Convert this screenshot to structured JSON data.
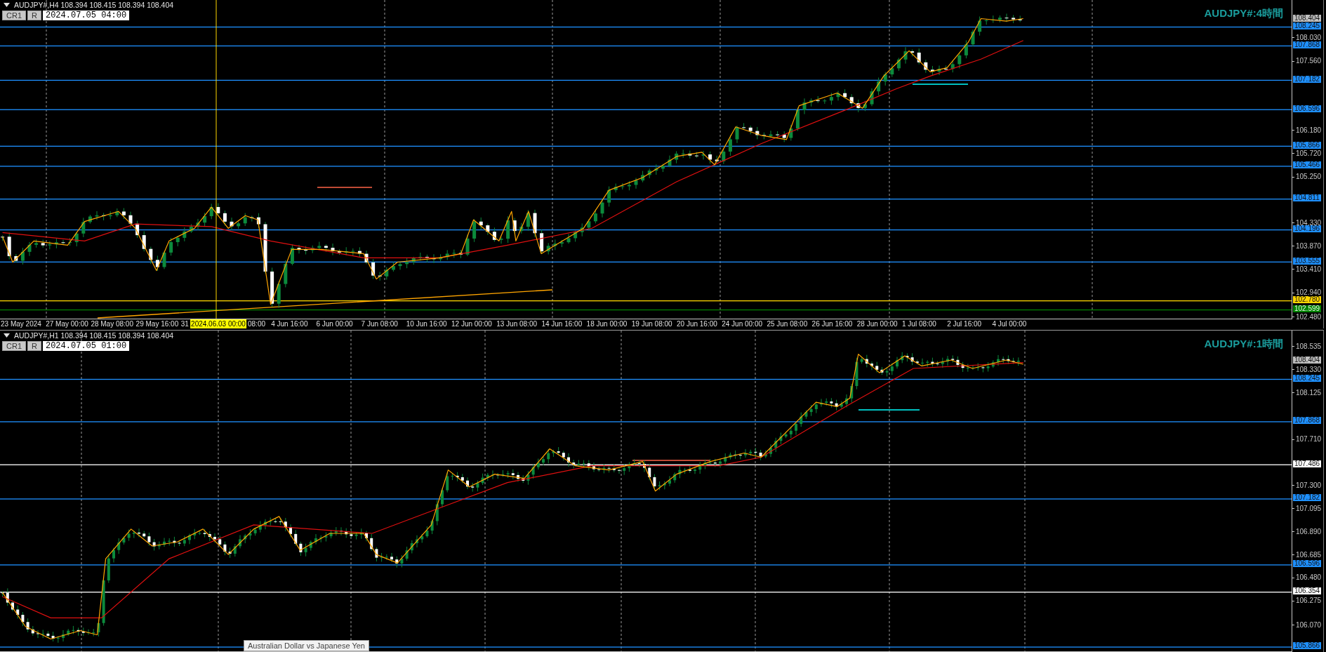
{
  "panes": [
    {
      "header": {
        "symbol_line": "AUDJPY#,H4  108.394 108.415 108.394 108.404",
        "buttons": [
          "CR1",
          "R"
        ],
        "date_field": "2024.07.05 04:00"
      },
      "title": "AUDJPY#:4時間",
      "price_ticks": [
        "108.030",
        "107.560",
        "106.180",
        "105.720",
        "105.250",
        "104.330",
        "103.870",
        "103.410",
        "102.940",
        "102.480"
      ],
      "levels": [
        {
          "label": "108.404",
          "kind": "bid",
          "color": "#c0c0c0"
        },
        {
          "label": "108.245",
          "kind": "line",
          "color": "#1e90ff"
        },
        {
          "label": "107.868",
          "kind": "line",
          "color": "#1e90ff"
        },
        {
          "label": "107.182",
          "kind": "line",
          "color": "#1e90ff"
        },
        {
          "label": "106.596",
          "kind": "line",
          "color": "#1e90ff"
        },
        {
          "label": "105.866",
          "kind": "line",
          "color": "#1e90ff"
        },
        {
          "label": "105.466",
          "kind": "line",
          "color": "#1e90ff"
        },
        {
          "label": "104.811",
          "kind": "line",
          "color": "#1e90ff"
        },
        {
          "label": "104.196",
          "kind": "line",
          "color": "#1e90ff"
        },
        {
          "label": "103.555",
          "kind": "line",
          "color": "#1e90ff"
        },
        {
          "label": "102.780",
          "kind": "line",
          "color": "#ffd700"
        },
        {
          "label": "102.599",
          "kind": "line",
          "color": "#008000"
        }
      ],
      "time_axis": [
        {
          "text": "23 May 2024",
          "kind": "date"
        },
        {
          "text": "27 May 00:00",
          "kind": "date"
        },
        {
          "text": "28 May 08:00",
          "kind": "date"
        },
        {
          "text": "29 May 16:00",
          "kind": "date"
        },
        {
          "text": "31",
          "kind": "date"
        },
        {
          "text": "2024.06.03 00:00",
          "kind": "cursor"
        },
        {
          "text": "08:00",
          "kind": "tail"
        },
        {
          "text": "4 Jun 16:00",
          "kind": "date"
        },
        {
          "text": "6 Jun 00:00",
          "kind": "date"
        },
        {
          "text": "7 Jun 08:00",
          "kind": "date"
        },
        {
          "text": "10 Jun 16:00",
          "kind": "date"
        },
        {
          "text": "12 Jun 00:00",
          "kind": "date"
        },
        {
          "text": "13 Jun 08:00",
          "kind": "date"
        },
        {
          "text": "14 Jun 16:00",
          "kind": "date"
        },
        {
          "text": "18 Jun 00:00",
          "kind": "date"
        },
        {
          "text": "19 Jun 08:00",
          "kind": "date"
        },
        {
          "text": "20 Jun 16:00",
          "kind": "date"
        },
        {
          "text": "24 Jun 00:00",
          "kind": "date"
        },
        {
          "text": "25 Jun 08:00",
          "kind": "date"
        },
        {
          "text": "26 Jun 16:00",
          "kind": "date"
        },
        {
          "text": "28 Jun 00:00",
          "kind": "date"
        },
        {
          "text": "1 Jul 08:00",
          "kind": "date"
        },
        {
          "text": "2 Jul 16:00",
          "kind": "date"
        },
        {
          "text": "4 Jul 00:00",
          "kind": "date"
        }
      ]
    },
    {
      "header": {
        "symbol_line": "AUDJPY#,H1  108.394 108.415 108.394 108.404",
        "buttons": [
          "CR1",
          "R"
        ],
        "date_field": "2024.07.05 01:00"
      },
      "title": "AUDJPY#:1時間",
      "price_ticks": [
        "108.535",
        "108.330",
        "108.125",
        "107.710",
        "107.300",
        "107.095",
        "106.890",
        "106.685",
        "106.480",
        "106.275",
        "106.070"
      ],
      "levels": [
        {
          "label": "108.404",
          "kind": "bid",
          "color": "#c0c0c0"
        },
        {
          "label": "108.245",
          "kind": "line",
          "color": "#1e90ff"
        },
        {
          "label": "107.868",
          "kind": "line",
          "color": "#1e90ff"
        },
        {
          "label": "107.486",
          "kind": "line",
          "color": "#ffffff"
        },
        {
          "label": "107.182",
          "kind": "line",
          "color": "#1e90ff"
        },
        {
          "label": "106.596",
          "kind": "line",
          "color": "#1e90ff"
        },
        {
          "label": "106.354",
          "kind": "line",
          "color": "#ffffff"
        },
        {
          "label": "105.866",
          "kind": "line",
          "color": "#1e90ff"
        }
      ],
      "tooltip": "Australian Dollar vs Japanese Yen"
    }
  ]
}
